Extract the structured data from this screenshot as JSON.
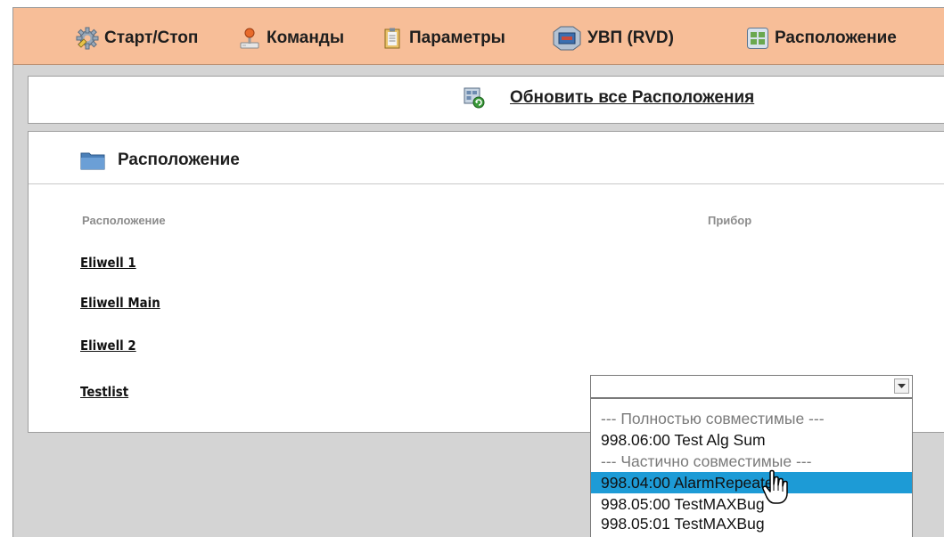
{
  "toolbar": {
    "items": [
      {
        "label": "Старт/Стоп",
        "icon": "gear-icon"
      },
      {
        "label": "Команды",
        "icon": "joystick-icon"
      },
      {
        "label": "Параметры",
        "icon": "clipboard-icon"
      },
      {
        "label": "УВП (RVD)",
        "icon": "monitor-icon"
      },
      {
        "label": "Расположение",
        "icon": "layout-grid-icon"
      }
    ]
  },
  "refresh": {
    "label": "Обновить все Расположения",
    "icon": "refresh-grid-icon"
  },
  "section": {
    "title": "Расположение",
    "icon": "folder-icon",
    "col_location": "Расположение",
    "col_device": "Прибор"
  },
  "locations": [
    "Eliwell 1",
    "Eliwell Main",
    "Eliwell 2",
    "Testlist"
  ],
  "device_select": {
    "value": "",
    "options": [
      {
        "label": "--- Полностью совместимые ---",
        "group": true
      },
      {
        "label": "998.06:00 Test Alg Sum"
      },
      {
        "label": "--- Частично совместимые ---",
        "group": true
      },
      {
        "label": "998.04:00 AlarmRepeater",
        "highlighted": true
      },
      {
        "label": "998.05:00 TestMAXBug"
      },
      {
        "label": "998.05:01 TestMAXBug"
      }
    ]
  },
  "colors": {
    "toolbar_bg": "#f7be98",
    "highlight": "#1d9bd6",
    "window_bg": "#d4d4d4"
  }
}
